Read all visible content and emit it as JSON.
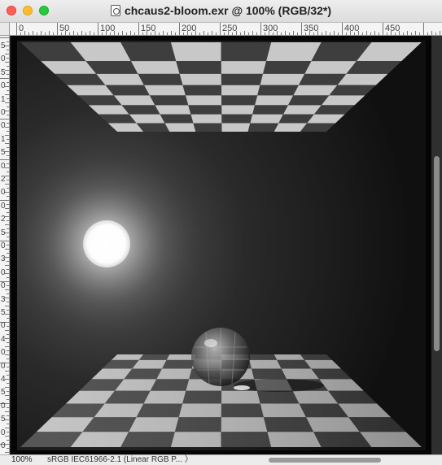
{
  "window": {
    "title": "chcaus2-bloom.exr @ 100% (RGB/32*)"
  },
  "ruler": {
    "horizontal_labels": [
      "0",
      "50",
      "100",
      "150",
      "200",
      "250",
      "300",
      "350",
      "400",
      "450"
    ],
    "vertical_labels": [
      "5",
      "0",
      "5",
      "0",
      "1",
      "0",
      "0",
      "1",
      "5",
      "0",
      "2",
      "0",
      "0",
      "2",
      "5",
      "0",
      "3",
      "0",
      "0",
      "3",
      "5",
      "0",
      "4",
      "0",
      "0",
      "4",
      "5",
      "0",
      "5",
      "0",
      "0"
    ]
  },
  "status": {
    "zoom": "100%",
    "color_profile": "sRGB IEC61966-2.1 (Linear RGB P...",
    "chevron": "〉"
  },
  "icons": {
    "document": "document-icon",
    "chevron": "chevron-right-icon"
  }
}
